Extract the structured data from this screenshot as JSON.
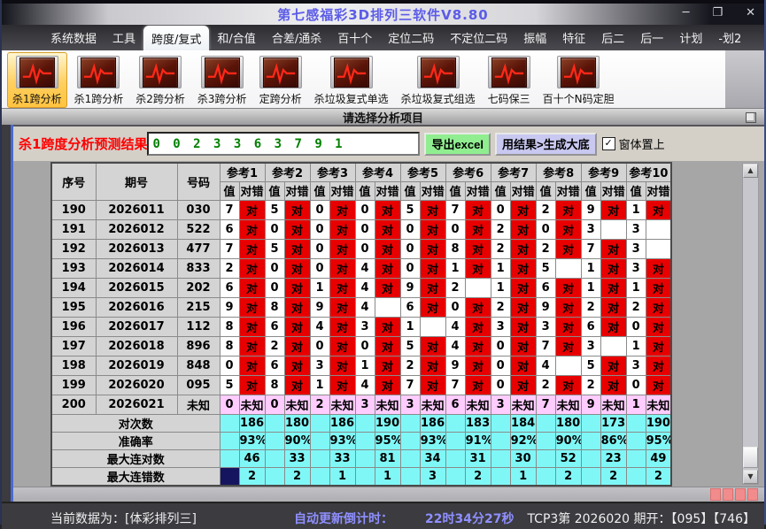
{
  "window": {
    "title": "第七感福彩3D排列三软件V8.80"
  },
  "icons": {
    "minimize": "─",
    "restore": "❐",
    "close": "✕",
    "check": "✓",
    "arrow_up": "▲",
    "arrow_down": "▼"
  },
  "menu": {
    "items": [
      "系统数据",
      "工具",
      "跨度/复式",
      "和/合值",
      "合差/通杀",
      "百十个",
      "定位二码",
      "不定位二码",
      "振幅",
      "特征",
      "后二",
      "后一",
      "计划",
      "-划2"
    ],
    "selected_index": 2
  },
  "toolbar": {
    "buttons": [
      {
        "label": "杀1跨分析",
        "selected": true
      },
      {
        "label": "杀1跨分析",
        "selected": false
      },
      {
        "label": "杀2跨分析",
        "selected": false
      },
      {
        "label": "杀3跨分析",
        "selected": false
      },
      {
        "label": "定跨分析",
        "selected": false
      },
      {
        "label": "杀垃圾复式单选",
        "selected": false
      },
      {
        "label": "杀垃圾复式组选",
        "selected": false
      },
      {
        "label": "七码保三",
        "selected": false
      },
      {
        "label": "百十个N码定胆",
        "selected": false
      }
    ],
    "hint": "请选择分析项目"
  },
  "result_bar": {
    "label": "杀1跨度分析预测结果",
    "value": "0 0 2 3 3 6 3 7 9 1",
    "export_label": "导出excel",
    "generate_label": "用结果>生成大底",
    "checkbox_label": "窗体置上",
    "checkbox_checked": true
  },
  "table": {
    "fixed_headers": [
      "序号",
      "期号",
      "号码"
    ],
    "groups": [
      "参考1",
      "参考2",
      "参考3",
      "参考4",
      "参考5",
      "参考6",
      "参考7",
      "参考8",
      "参考9",
      "参考10"
    ],
    "sub_headers": [
      "值",
      "对错"
    ],
    "rows": [
      {
        "seq": "190",
        "period": "2026011",
        "code": "030",
        "values": [
          7,
          5,
          0,
          0,
          5,
          7,
          0,
          2,
          9,
          1
        ],
        "marks": [
          "对",
          "对",
          "对",
          "对",
          "对",
          "对",
          "对",
          "对",
          "对",
          "对"
        ]
      },
      {
        "seq": "191",
        "period": "2026012",
        "code": "522",
        "values": [
          6,
          0,
          0,
          0,
          0,
          0,
          2,
          0,
          3,
          3
        ],
        "marks": [
          "对",
          "对",
          "对",
          "对",
          "对",
          "对",
          "对",
          "对",
          "",
          ""
        ]
      },
      {
        "seq": "192",
        "period": "2026013",
        "code": "477",
        "values": [
          7,
          5,
          0,
          0,
          0,
          8,
          2,
          2,
          7,
          3
        ],
        "marks": [
          "对",
          "对",
          "对",
          "对",
          "对",
          "对",
          "对",
          "对",
          "对",
          ""
        ]
      },
      {
        "seq": "193",
        "period": "2026014",
        "code": "833",
        "values": [
          2,
          0,
          0,
          4,
          0,
          1,
          1,
          5,
          1,
          3
        ],
        "marks": [
          "对",
          "对",
          "对",
          "对",
          "对",
          "对",
          "对",
          "",
          "对",
          "对"
        ]
      },
      {
        "seq": "194",
        "period": "2026015",
        "code": "202",
        "values": [
          6,
          0,
          1,
          4,
          9,
          2,
          1,
          6,
          1,
          1
        ],
        "marks": [
          "对",
          "对",
          "对",
          "对",
          "对",
          "",
          "对",
          "对",
          "对",
          "对"
        ]
      },
      {
        "seq": "195",
        "period": "2026016",
        "code": "215",
        "values": [
          9,
          8,
          9,
          4,
          6,
          0,
          2,
          9,
          2,
          2
        ],
        "marks": [
          "对",
          "对",
          "对",
          "",
          "对",
          "对",
          "对",
          "对",
          "对",
          "对"
        ]
      },
      {
        "seq": "196",
        "period": "2026017",
        "code": "112",
        "values": [
          8,
          6,
          4,
          3,
          1,
          4,
          3,
          3,
          6,
          0
        ],
        "marks": [
          "对",
          "对",
          "对",
          "对",
          "",
          "对",
          "对",
          "对",
          "对",
          "对"
        ]
      },
      {
        "seq": "197",
        "period": "2026018",
        "code": "896",
        "values": [
          8,
          2,
          0,
          0,
          5,
          4,
          0,
          7,
          3,
          1
        ],
        "marks": [
          "对",
          "对",
          "对",
          "对",
          "对",
          "对",
          "对",
          "对",
          "",
          "对"
        ]
      },
      {
        "seq": "198",
        "period": "2026019",
        "code": "848",
        "values": [
          0,
          6,
          3,
          1,
          2,
          9,
          0,
          4,
          5,
          3
        ],
        "marks": [
          "对",
          "对",
          "对",
          "对",
          "对",
          "对",
          "对",
          "",
          "对",
          "对"
        ]
      },
      {
        "seq": "199",
        "period": "2026020",
        "code": "095",
        "values": [
          5,
          8,
          1,
          4,
          7,
          7,
          0,
          2,
          2,
          0
        ],
        "marks": [
          "对",
          "对",
          "对",
          "对",
          "对",
          "对",
          "对",
          "对",
          "对",
          "对"
        ]
      },
      {
        "seq": "200",
        "period": "2026021",
        "code": "未知",
        "values": [
          0,
          0,
          2,
          3,
          3,
          6,
          3,
          7,
          9,
          1
        ],
        "marks": [
          "未知",
          "未知",
          "未知",
          "未知",
          "未知",
          "未知",
          "未知",
          "未知",
          "未知",
          "未知"
        ]
      }
    ],
    "summary_rows": [
      {
        "label": "对次数",
        "values": [
          "186",
          "180",
          "186",
          "190",
          "186",
          "183",
          "184",
          "180",
          "173",
          "190"
        ]
      },
      {
        "label": "准确率",
        "values": [
          "93%",
          "90%",
          "93%",
          "95%",
          "93%",
          "91%",
          "92%",
          "90%",
          "86%",
          "95%"
        ]
      },
      {
        "label": "最大连对数",
        "values": [
          "46",
          "33",
          "33",
          "81",
          "34",
          "31",
          "30",
          "52",
          "23",
          "49"
        ]
      },
      {
        "label": "最大连错数",
        "values": [
          "2",
          "2",
          "1",
          "1",
          "3",
          "2",
          "1",
          "2",
          "2",
          "2"
        ]
      }
    ],
    "selected_cell": {
      "summary_label": "最大连错数",
      "column": "参考1-值"
    }
  },
  "status_bar": {
    "current_data": "当前数据为：[体彩排列三]",
    "countdown_label": "自动更新倒计时：",
    "countdown_value": "22时34分27秒",
    "draw_info": "TCP3第 2026020 期开：【095】【746】"
  },
  "colors": {
    "hit_cell": "#e80000",
    "miss_value_text": "#990000",
    "unknown_row_bg": "#ffccff",
    "unknown_text": "#1414cc",
    "summary_cell_bg": "#80f7f7",
    "summary_text": "#0000d2",
    "selected_cell_bg": "#15155f",
    "title_text": "#5c5ce8",
    "result_label": "#ff0000",
    "prediction_text": "#008000",
    "export_button_bg": "#90ee90",
    "generate_button_bg": "#c8c8f0",
    "countdown_text": "#8f8fff",
    "indicator_square": "#f28c8c"
  }
}
